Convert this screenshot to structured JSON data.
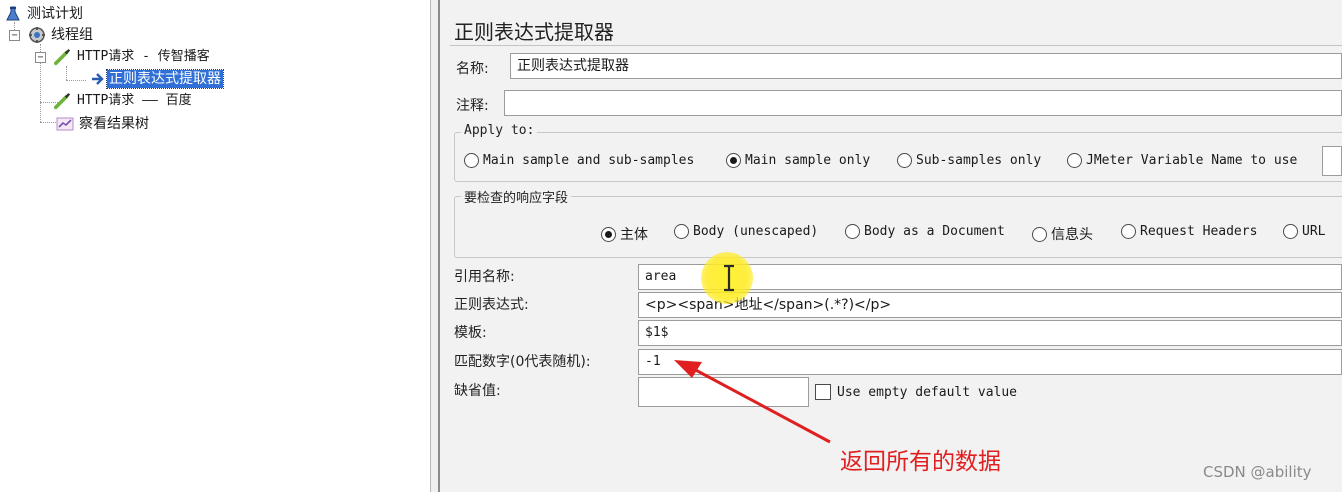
{
  "tree": {
    "items": [
      {
        "label": "测试计划",
        "icon": "test-plan-icon"
      },
      {
        "label": "线程组",
        "icon": "thread-group-icon"
      },
      {
        "label": "HTTP请求 - 传智播客",
        "icon": "http-sampler-icon"
      },
      {
        "label": "正则表达式提取器",
        "icon": "regex-extractor-icon"
      },
      {
        "label": "HTTP请求 —— 百度",
        "icon": "http-sampler-icon"
      },
      {
        "label": "察看结果树",
        "icon": "results-tree-icon"
      }
    ]
  },
  "panel": {
    "title": "正则表达式提取器",
    "name_label": "名称:",
    "name_value": "正则表达式提取器",
    "comment_label": "注释:",
    "comment_value": "",
    "apply_to": {
      "title": "Apply to:",
      "options": [
        {
          "label": "Main sample and sub-samples",
          "selected": false
        },
        {
          "label": "Main sample only",
          "selected": true
        },
        {
          "label": "Sub-samples only",
          "selected": false
        },
        {
          "label": "JMeter Variable Name to use",
          "selected": false
        }
      ]
    },
    "response_field": {
      "title": "要检查的响应字段",
      "options": [
        {
          "label": "主体",
          "selected": true
        },
        {
          "label": "Body (unescaped)",
          "selected": false
        },
        {
          "label": "Body as a Document",
          "selected": false
        },
        {
          "label": "信息头",
          "selected": false
        },
        {
          "label": "Request Headers",
          "selected": false
        },
        {
          "label": "URL",
          "selected": false
        }
      ]
    },
    "ref_name_label": "引用名称:",
    "ref_name_value": "area",
    "regex_label": "正则表达式:",
    "regex_value": "<p><span>地址</span>(.*?)</p>",
    "template_label": "模板:",
    "template_value": "$1$",
    "match_no_label": "匹配数字(0代表随机):",
    "match_no_value": "-1",
    "default_label": "缺省值:",
    "default_value": "",
    "use_empty_default_label": "Use empty default value",
    "use_empty_default_checked": false
  },
  "annotation": {
    "text": "返回所有的数据",
    "color": "#e02020"
  },
  "watermark": "CSDN @ability",
  "colors": {
    "selection": "#2f6fd6",
    "panel_bg": "#f2f2f2",
    "cursor_highlight": "#ffeb1e"
  }
}
